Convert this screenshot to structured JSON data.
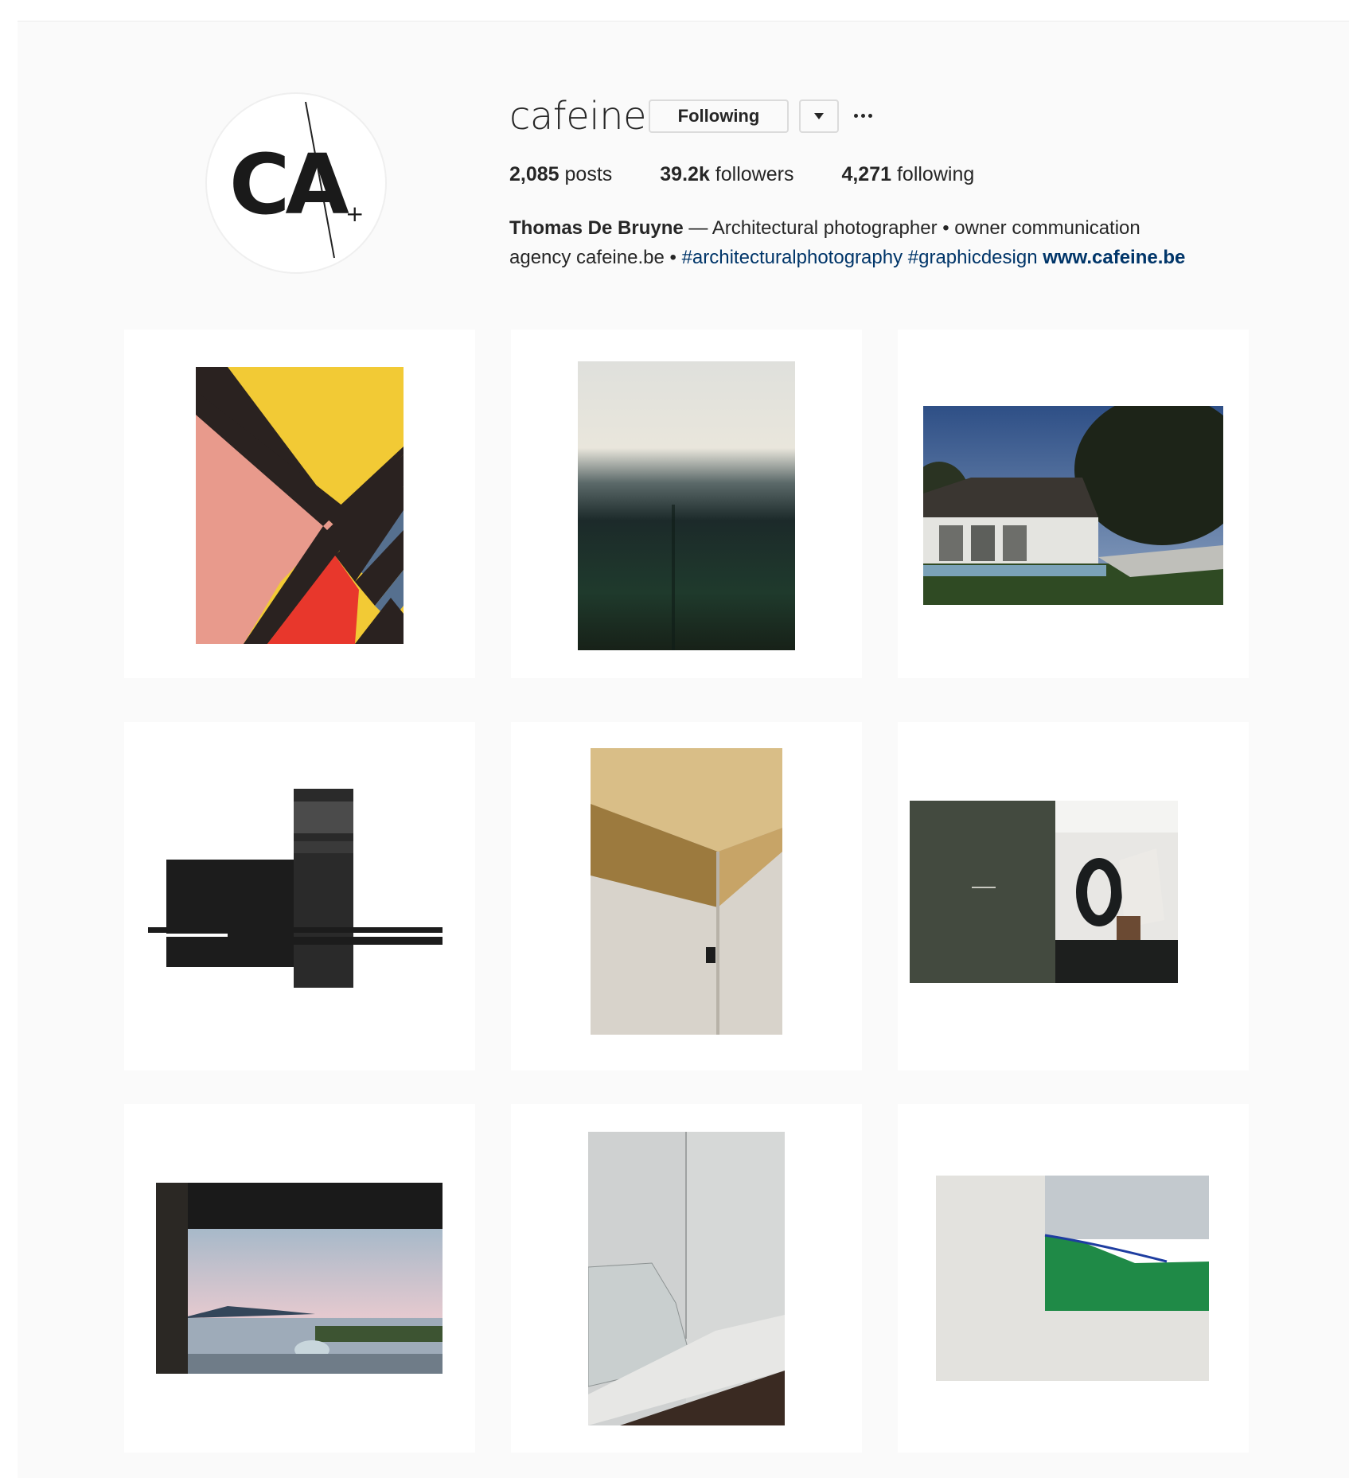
{
  "profile": {
    "username": "cafeine",
    "avatar_text": "CA",
    "avatar_mark": "+",
    "following_button": "Following",
    "stats": {
      "posts_count": "2,085",
      "posts_label": "posts",
      "followers_count": "39.2k",
      "followers_label": "followers",
      "following_count": "4,271",
      "following_label": "following"
    },
    "bio": {
      "name": "Thomas De Bruyne",
      "text_1": " — Architectural photographer • owner communication",
      "text_2": "agency cafeine.be • ",
      "hashtag_1": "#architecturalphotography",
      "hashtag_2": "#graphicdesign",
      "website": "www.cafeine.be"
    }
  },
  "posts": [
    {
      "subject": "geometric-color-blocks"
    },
    {
      "subject": "misty-window-green"
    },
    {
      "subject": "modern-house-pool"
    },
    {
      "subject": "black-abstract-blocks"
    },
    {
      "subject": "brass-stone-detail"
    },
    {
      "subject": "dark-green-book-spread-interior"
    },
    {
      "subject": "window-sea-view-dusk"
    },
    {
      "subject": "concrete-stair-geometry"
    },
    {
      "subject": "green-painting-on-wall"
    }
  ],
  "colors": {
    "link": "#003569",
    "text": "#262626",
    "page_bg": "#fafafa",
    "border": "#dbdbdb"
  }
}
